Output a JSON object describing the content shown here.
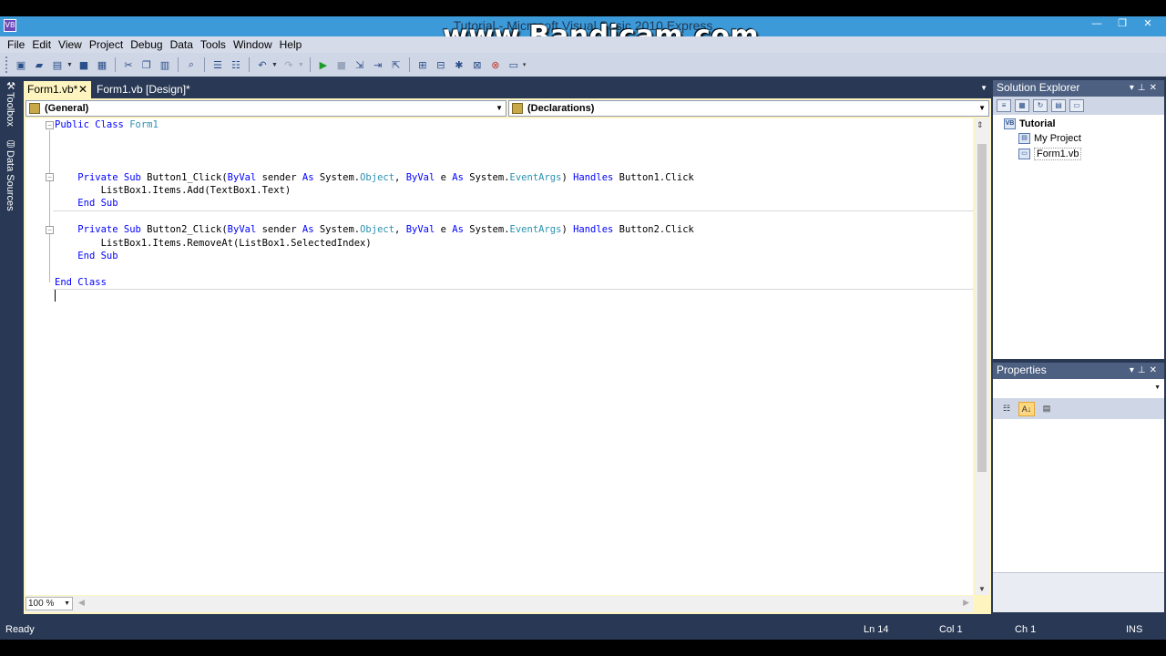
{
  "window": {
    "title": "Tutorial - Microsoft Visual Basic 2010 Express",
    "watermark": "www.Bandicam.com",
    "app_icon": "VB",
    "controls": [
      "—",
      "❐",
      "✕"
    ]
  },
  "menu": [
    "File",
    "Edit",
    "View",
    "Project",
    "Debug",
    "Data",
    "Tools",
    "Window",
    "Help"
  ],
  "toolbar": {
    "icons": [
      "new-project-icon",
      "open-file-icon",
      "add-item-icon",
      "save-icon",
      "save-all-icon",
      "cut-icon",
      "copy-icon",
      "paste-icon",
      "find-icon",
      "comment-icon",
      "uncomment-icon",
      "undo-icon",
      "redo-icon",
      "start-debugging-icon",
      "stop-debugging-icon",
      "step-into-icon",
      "step-over-icon",
      "step-out-icon",
      "solution-explorer-icon",
      "properties-icon",
      "object-browser-icon",
      "toolbox-icon",
      "error-list-icon",
      "immediate-window-icon"
    ]
  },
  "side_tabs": {
    "toolbox": "Toolbox",
    "data_sources": "Data Sources"
  },
  "tabs": {
    "active": "Form1.vb*",
    "inactive": "Form1.vb [Design]*"
  },
  "combos": {
    "general": "(General)",
    "declarations": "(Declarations)"
  },
  "code_lines": [
    [
      {
        "t": "Public Class ",
        "c": "kw"
      },
      {
        "t": "Form1",
        "c": "ty"
      }
    ],
    [],
    [],
    [],
    [
      {
        "t": "    "
      },
      {
        "t": "Private Sub ",
        "c": "kw"
      },
      {
        "t": "Button1_Click("
      },
      {
        "t": "ByVal ",
        "c": "kw"
      },
      {
        "t": "sender "
      },
      {
        "t": "As ",
        "c": "kw"
      },
      {
        "t": "System."
      },
      {
        "t": "Object",
        "c": "ty"
      },
      {
        "t": ", "
      },
      {
        "t": "ByVal ",
        "c": "kw"
      },
      {
        "t": "e "
      },
      {
        "t": "As ",
        "c": "kw"
      },
      {
        "t": "System."
      },
      {
        "t": "EventArgs",
        "c": "ty"
      },
      {
        "t": ") "
      },
      {
        "t": "Handles ",
        "c": "kw"
      },
      {
        "t": "Button1.Click"
      }
    ],
    [
      {
        "t": "        ListBox1.Items.Add(TextBox1.Text)"
      }
    ],
    [
      {
        "t": "    "
      },
      {
        "t": "End Sub",
        "c": "kw"
      }
    ],
    [],
    [
      {
        "t": "    "
      },
      {
        "t": "Private Sub ",
        "c": "kw"
      },
      {
        "t": "Button2_Click("
      },
      {
        "t": "ByVal ",
        "c": "kw"
      },
      {
        "t": "sender "
      },
      {
        "t": "As ",
        "c": "kw"
      },
      {
        "t": "System."
      },
      {
        "t": "Object",
        "c": "ty"
      },
      {
        "t": ", "
      },
      {
        "t": "ByVal ",
        "c": "kw"
      },
      {
        "t": "e "
      },
      {
        "t": "As ",
        "c": "kw"
      },
      {
        "t": "System."
      },
      {
        "t": "EventArgs",
        "c": "ty"
      },
      {
        "t": ") "
      },
      {
        "t": "Handles ",
        "c": "kw"
      },
      {
        "t": "Button2.Click"
      }
    ],
    [
      {
        "t": "        ListBox1.Items.RemoveAt(ListBox1.SelectedIndex)"
      }
    ],
    [
      {
        "t": "    "
      },
      {
        "t": "End Sub",
        "c": "kw"
      }
    ],
    [],
    [
      {
        "t": "End Class",
        "c": "kw"
      }
    ],
    []
  ],
  "editor": {
    "zoom": "100 %"
  },
  "solution_explorer": {
    "title": "Solution Explorer",
    "tree": [
      "Tutorial",
      "My Project",
      "Form1.vb"
    ]
  },
  "properties": {
    "title": "Properties"
  },
  "status": {
    "text": "Ready",
    "line": "Ln 14",
    "col": "Col 1",
    "ch": "Ch 1",
    "mode": "INS"
  },
  "colors": {
    "keyword": "#0000ff",
    "type": "#2b91af",
    "chrome": "#293955",
    "active_tab": "#fdf4bf"
  }
}
